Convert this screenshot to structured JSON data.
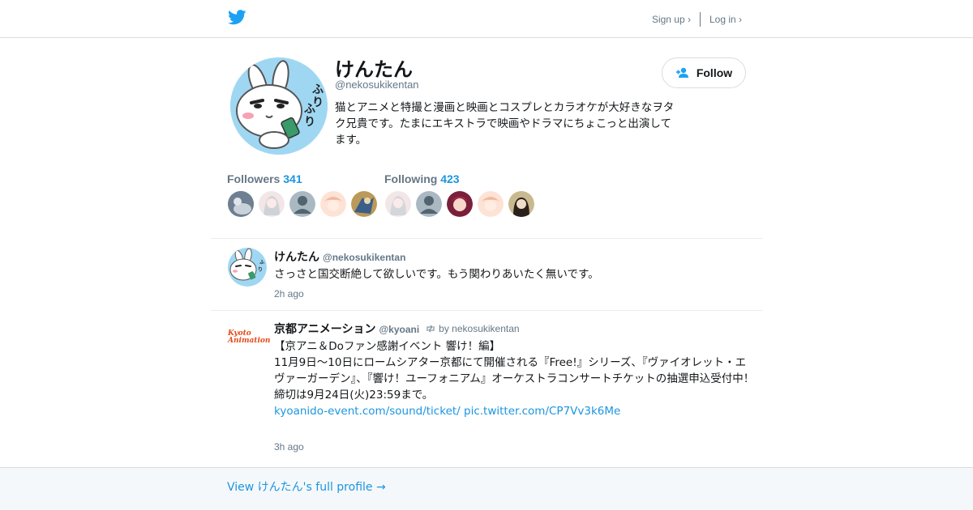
{
  "header": {
    "signup_label": "Sign up ›",
    "login_label": "Log in ›"
  },
  "profile": {
    "name": "けんたん",
    "handle": "@nekosukikentan",
    "bio": "猫とアニメと特撮と漫画と映画とコスプレとカラオケが大好きなヲタク兄貴です。たまにエキストラで映画やドラマにちょこっと出演してます。",
    "follow_label": "Follow",
    "followers_label": "Followers",
    "followers_count": "341",
    "following_label": "Following",
    "following_count": "423"
  },
  "tweets": [
    {
      "name": "けんたん",
      "handle": "@nekosukikentan",
      "text": "さっさと国交断絶して欲しいです。もう関わりあいたく無いです。",
      "time": "2h ago"
    },
    {
      "name": "京都アニメーション",
      "handle": "@kyoani",
      "retweeted_by": "by nekosukikentan",
      "logo_text": "Kyoto Animation",
      "lines": [
        "【京アニ＆Doファン感謝イベント 響け！編】",
        "11月9日～10日にロームシアター京都にて開催される『Free!』シリーズ、『ヴァイオレット・エヴァーガーデン』、『響け！ユーフォニアム』オーケストラコンサートチケットの抽選申込受付中！",
        "締切は9月24日(火)23:59まで。"
      ],
      "link1": "kyoanido-event.com/sound/ticket/",
      "link2": "pic.twitter.com/CP7Vv3k6Me",
      "time": "3h ago"
    }
  ],
  "footer": {
    "view_profile_label": "View けんたん's full profile →"
  },
  "colors": {
    "twitter_blue": "#1da1f2",
    "link_blue": "#1b95e0",
    "secondary_text": "#657786"
  }
}
